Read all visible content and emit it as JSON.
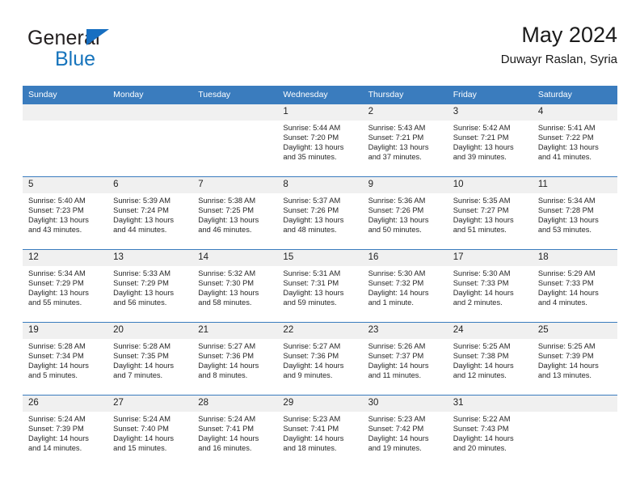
{
  "logo": {
    "text_primary": "General",
    "text_secondary": "Blue",
    "icon": "triangle-icon",
    "color_primary": "#231f20",
    "color_secondary": "#1774bc"
  },
  "header": {
    "title": "May 2024",
    "subtitle": "Duwayr Raslan, Syria"
  },
  "colors": {
    "header_row_bg": "#3a7cbe",
    "day_number_bg": "#f0f0f0",
    "row_separator": "#3a7cbe",
    "text": "#262626"
  },
  "weekday_headers": [
    "Sunday",
    "Monday",
    "Tuesday",
    "Wednesday",
    "Thursday",
    "Friday",
    "Saturday"
  ],
  "labels": {
    "sunrise": "Sunrise:",
    "sunset": "Sunset:",
    "daylight": "Daylight:"
  },
  "weeks": [
    [
      {
        "day": "",
        "sunrise": "",
        "sunset": "",
        "daylight_1": "",
        "daylight_2": ""
      },
      {
        "day": "",
        "sunrise": "",
        "sunset": "",
        "daylight_1": "",
        "daylight_2": ""
      },
      {
        "day": "",
        "sunrise": "",
        "sunset": "",
        "daylight_1": "",
        "daylight_2": ""
      },
      {
        "day": "1",
        "sunrise": "Sunrise: 5:44 AM",
        "sunset": "Sunset: 7:20 PM",
        "daylight_1": "Daylight: 13 hours",
        "daylight_2": "and 35 minutes."
      },
      {
        "day": "2",
        "sunrise": "Sunrise: 5:43 AM",
        "sunset": "Sunset: 7:21 PM",
        "daylight_1": "Daylight: 13 hours",
        "daylight_2": "and 37 minutes."
      },
      {
        "day": "3",
        "sunrise": "Sunrise: 5:42 AM",
        "sunset": "Sunset: 7:21 PM",
        "daylight_1": "Daylight: 13 hours",
        "daylight_2": "and 39 minutes."
      },
      {
        "day": "4",
        "sunrise": "Sunrise: 5:41 AM",
        "sunset": "Sunset: 7:22 PM",
        "daylight_1": "Daylight: 13 hours",
        "daylight_2": "and 41 minutes."
      }
    ],
    [
      {
        "day": "5",
        "sunrise": "Sunrise: 5:40 AM",
        "sunset": "Sunset: 7:23 PM",
        "daylight_1": "Daylight: 13 hours",
        "daylight_2": "and 43 minutes."
      },
      {
        "day": "6",
        "sunrise": "Sunrise: 5:39 AM",
        "sunset": "Sunset: 7:24 PM",
        "daylight_1": "Daylight: 13 hours",
        "daylight_2": "and 44 minutes."
      },
      {
        "day": "7",
        "sunrise": "Sunrise: 5:38 AM",
        "sunset": "Sunset: 7:25 PM",
        "daylight_1": "Daylight: 13 hours",
        "daylight_2": "and 46 minutes."
      },
      {
        "day": "8",
        "sunrise": "Sunrise: 5:37 AM",
        "sunset": "Sunset: 7:26 PM",
        "daylight_1": "Daylight: 13 hours",
        "daylight_2": "and 48 minutes."
      },
      {
        "day": "9",
        "sunrise": "Sunrise: 5:36 AM",
        "sunset": "Sunset: 7:26 PM",
        "daylight_1": "Daylight: 13 hours",
        "daylight_2": "and 50 minutes."
      },
      {
        "day": "10",
        "sunrise": "Sunrise: 5:35 AM",
        "sunset": "Sunset: 7:27 PM",
        "daylight_1": "Daylight: 13 hours",
        "daylight_2": "and 51 minutes."
      },
      {
        "day": "11",
        "sunrise": "Sunrise: 5:34 AM",
        "sunset": "Sunset: 7:28 PM",
        "daylight_1": "Daylight: 13 hours",
        "daylight_2": "and 53 minutes."
      }
    ],
    [
      {
        "day": "12",
        "sunrise": "Sunrise: 5:34 AM",
        "sunset": "Sunset: 7:29 PM",
        "daylight_1": "Daylight: 13 hours",
        "daylight_2": "and 55 minutes."
      },
      {
        "day": "13",
        "sunrise": "Sunrise: 5:33 AM",
        "sunset": "Sunset: 7:29 PM",
        "daylight_1": "Daylight: 13 hours",
        "daylight_2": "and 56 minutes."
      },
      {
        "day": "14",
        "sunrise": "Sunrise: 5:32 AM",
        "sunset": "Sunset: 7:30 PM",
        "daylight_1": "Daylight: 13 hours",
        "daylight_2": "and 58 minutes."
      },
      {
        "day": "15",
        "sunrise": "Sunrise: 5:31 AM",
        "sunset": "Sunset: 7:31 PM",
        "daylight_1": "Daylight: 13 hours",
        "daylight_2": "and 59 minutes."
      },
      {
        "day": "16",
        "sunrise": "Sunrise: 5:30 AM",
        "sunset": "Sunset: 7:32 PM",
        "daylight_1": "Daylight: 14 hours",
        "daylight_2": "and 1 minute."
      },
      {
        "day": "17",
        "sunrise": "Sunrise: 5:30 AM",
        "sunset": "Sunset: 7:33 PM",
        "daylight_1": "Daylight: 14 hours",
        "daylight_2": "and 2 minutes."
      },
      {
        "day": "18",
        "sunrise": "Sunrise: 5:29 AM",
        "sunset": "Sunset: 7:33 PM",
        "daylight_1": "Daylight: 14 hours",
        "daylight_2": "and 4 minutes."
      }
    ],
    [
      {
        "day": "19",
        "sunrise": "Sunrise: 5:28 AM",
        "sunset": "Sunset: 7:34 PM",
        "daylight_1": "Daylight: 14 hours",
        "daylight_2": "and 5 minutes."
      },
      {
        "day": "20",
        "sunrise": "Sunrise: 5:28 AM",
        "sunset": "Sunset: 7:35 PM",
        "daylight_1": "Daylight: 14 hours",
        "daylight_2": "and 7 minutes."
      },
      {
        "day": "21",
        "sunrise": "Sunrise: 5:27 AM",
        "sunset": "Sunset: 7:36 PM",
        "daylight_1": "Daylight: 14 hours",
        "daylight_2": "and 8 minutes."
      },
      {
        "day": "22",
        "sunrise": "Sunrise: 5:27 AM",
        "sunset": "Sunset: 7:36 PM",
        "daylight_1": "Daylight: 14 hours",
        "daylight_2": "and 9 minutes."
      },
      {
        "day": "23",
        "sunrise": "Sunrise: 5:26 AM",
        "sunset": "Sunset: 7:37 PM",
        "daylight_1": "Daylight: 14 hours",
        "daylight_2": "and 11 minutes."
      },
      {
        "day": "24",
        "sunrise": "Sunrise: 5:25 AM",
        "sunset": "Sunset: 7:38 PM",
        "daylight_1": "Daylight: 14 hours",
        "daylight_2": "and 12 minutes."
      },
      {
        "day": "25",
        "sunrise": "Sunrise: 5:25 AM",
        "sunset": "Sunset: 7:39 PM",
        "daylight_1": "Daylight: 14 hours",
        "daylight_2": "and 13 minutes."
      }
    ],
    [
      {
        "day": "26",
        "sunrise": "Sunrise: 5:24 AM",
        "sunset": "Sunset: 7:39 PM",
        "daylight_1": "Daylight: 14 hours",
        "daylight_2": "and 14 minutes."
      },
      {
        "day": "27",
        "sunrise": "Sunrise: 5:24 AM",
        "sunset": "Sunset: 7:40 PM",
        "daylight_1": "Daylight: 14 hours",
        "daylight_2": "and 15 minutes."
      },
      {
        "day": "28",
        "sunrise": "Sunrise: 5:24 AM",
        "sunset": "Sunset: 7:41 PM",
        "daylight_1": "Daylight: 14 hours",
        "daylight_2": "and 16 minutes."
      },
      {
        "day": "29",
        "sunrise": "Sunrise: 5:23 AM",
        "sunset": "Sunset: 7:41 PM",
        "daylight_1": "Daylight: 14 hours",
        "daylight_2": "and 18 minutes."
      },
      {
        "day": "30",
        "sunrise": "Sunrise: 5:23 AM",
        "sunset": "Sunset: 7:42 PM",
        "daylight_1": "Daylight: 14 hours",
        "daylight_2": "and 19 minutes."
      },
      {
        "day": "31",
        "sunrise": "Sunrise: 5:22 AM",
        "sunset": "Sunset: 7:43 PM",
        "daylight_1": "Daylight: 14 hours",
        "daylight_2": "and 20 minutes."
      },
      {
        "day": "",
        "sunrise": "",
        "sunset": "",
        "daylight_1": "",
        "daylight_2": ""
      }
    ]
  ]
}
